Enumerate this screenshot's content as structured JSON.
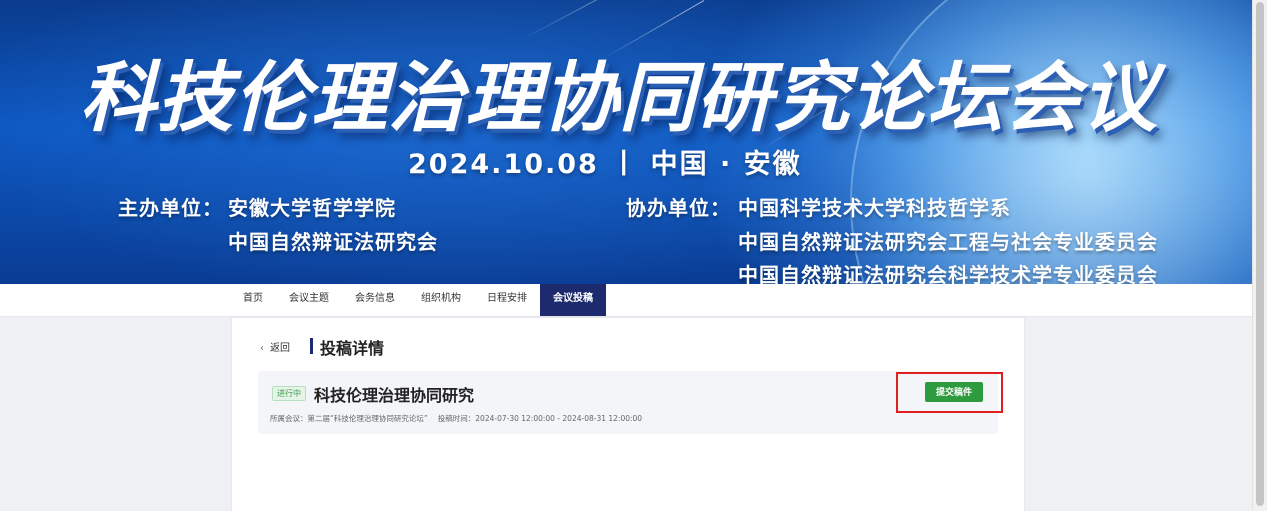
{
  "banner": {
    "title": "科技伦理治理协同研究论坛会议",
    "dateline": "2024.10.08 丨 中国 · 安徽",
    "host_label": "主办单位：",
    "host_1": "安徽大学哲学学院",
    "host_2": "中国自然辩证法研究会",
    "cohost_label": "协办单位：",
    "cohost_1": "中国科学技术大学科技哲学系",
    "cohost_2": "中国自然辩证法研究会工程与社会专业委员会",
    "cohost_3": "中国自然辩证法研究会科学技术学专业委员会"
  },
  "nav": {
    "items": [
      "首页",
      "会议主题",
      "会务信息",
      "组织机构",
      "日程安排",
      "会议投稿"
    ],
    "active": "会议投稿"
  },
  "detail": {
    "back_label": "返回",
    "section_title": "投稿详情",
    "status_badge": "进行中",
    "paper_title": "科技伦理治理协同研究",
    "meeting_text": "所属会议：第二届“科技伦理治理协同研究论坛”",
    "time_text": "投稿时间：2024-07-30 12:00:00 - 2024-08-31 12:00:00",
    "submit_label": "提交稿件"
  },
  "colors": {
    "nav_active_bg": "#1d2a6e",
    "submit_green": "#2e9b3e",
    "highlight_red": "#e02020"
  }
}
